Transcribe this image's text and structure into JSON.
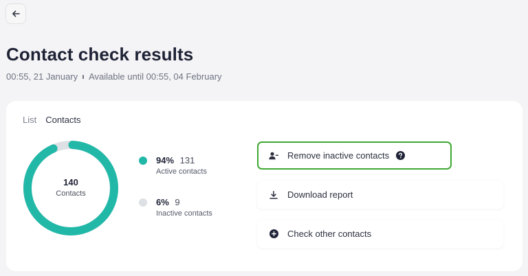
{
  "header": {
    "back_icon": "arrow-left-icon",
    "title": "Contact check results",
    "created": "00:55, 21 January",
    "available": "Available until 00:55, 04 February"
  },
  "tabs": [
    {
      "label": "List",
      "active": false
    },
    {
      "label": "Contacts",
      "active": true
    }
  ],
  "summary": {
    "total_value": "140",
    "total_label": "Contacts",
    "active": {
      "percent": "94%",
      "count": "131",
      "label": "Active contacts",
      "fraction": 0.94,
      "color": "#22b8a8"
    },
    "inactive": {
      "percent": "6%",
      "count": "9",
      "label": "Inactive contacts",
      "fraction": 0.06,
      "color": "#dde0e5"
    }
  },
  "actions": [
    {
      "label": "Remove inactive contacts",
      "icon": "user-remove-icon",
      "help_icon": "help-circle-icon",
      "highlighted": true
    },
    {
      "label": "Download report",
      "icon": "download-icon"
    },
    {
      "label": "Check other contacts",
      "icon": "plus-circle-icon"
    }
  ],
  "colors": {
    "accent": "#22b8a8",
    "highlight_border": "#3ea832",
    "text_primary": "#1e2235",
    "text_muted": "#6f7382"
  }
}
